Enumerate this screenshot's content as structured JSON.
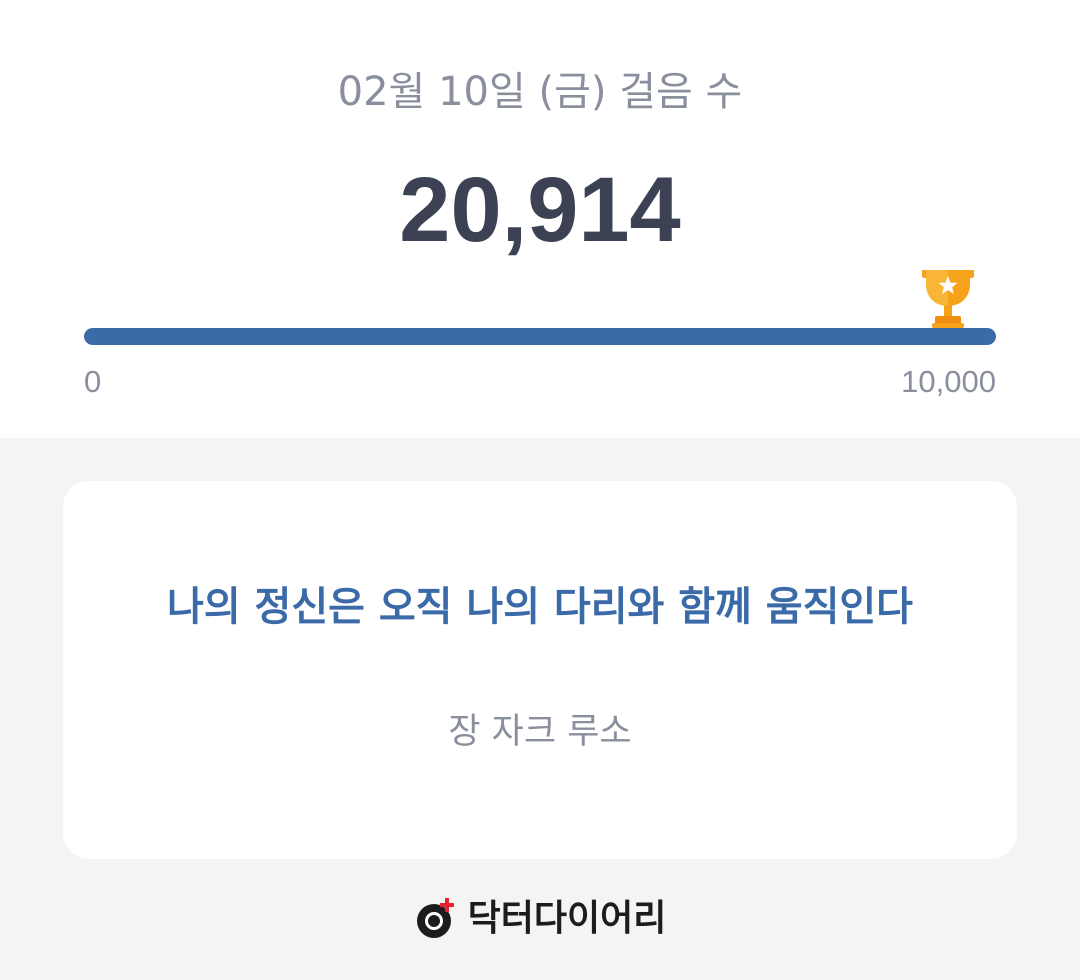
{
  "header": {
    "title": "02월 10일 (금) 걸음 수"
  },
  "steps": {
    "count": "20,914",
    "goal_progress": 1.0
  },
  "scale": {
    "min_label": "0",
    "max_label": "10,000"
  },
  "quote": {
    "text": "나의 정신은 오직 나의 다리와 함께 움직인다",
    "author": "장 자크 루소"
  },
  "brand": {
    "name": "닥터다이어리",
    "icon": "doctor-diary-logo-icon"
  },
  "colors": {
    "accent": "#3a6aa8",
    "trophy": "#f7a21b",
    "text_primary": "#3c4254",
    "text_secondary": "#8a8f9e",
    "background": "#f4f4f4"
  }
}
